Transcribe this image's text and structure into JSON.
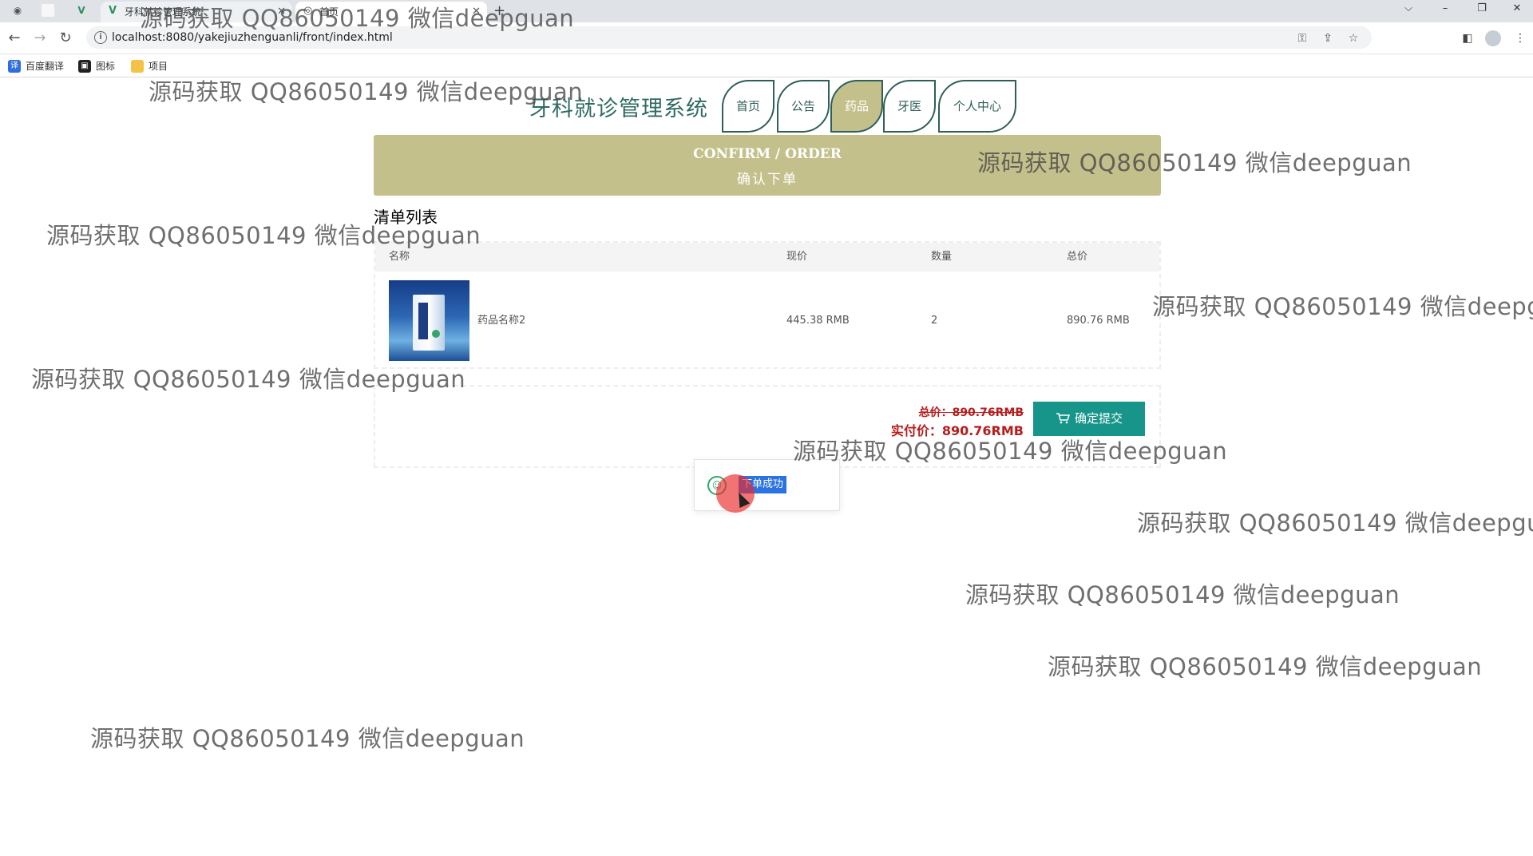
{
  "browser": {
    "tabs": [
      {
        "label": "",
        "icon": "blank-page-icon"
      },
      {
        "label": "牙科就诊管理系统",
        "icon": "vue-logo-icon"
      },
      {
        "label": "首页",
        "icon": "globe-icon"
      }
    ],
    "new_tab": "+",
    "url": "localhost:8080/yakejiuzhenguanli/front/index.html",
    "window_controls": {
      "dropdown": "⌵",
      "minimize": "–",
      "restore": "❐",
      "close": "✕"
    },
    "bookmarks": [
      {
        "label": "百度翻译",
        "icon": "baidu-translate-icon",
        "color": "#2f6de1"
      },
      {
        "label": "图标",
        "icon": "image-icon",
        "color": "#222222"
      },
      {
        "label": "项目",
        "icon": "folder-icon",
        "color": "#f3c246"
      }
    ]
  },
  "site": {
    "title": "牙科就诊管理系统",
    "nav": [
      {
        "label": "首页",
        "active": false
      },
      {
        "label": "公告",
        "active": false
      },
      {
        "label": "药品",
        "active": true
      },
      {
        "label": "牙医",
        "active": false
      },
      {
        "label": "个人中心",
        "active": false
      }
    ],
    "accent": "#c4c08c",
    "nav_color": "#2e5f59"
  },
  "banner": {
    "en": "CONFIRM / ORDER",
    "cn": "确认下单"
  },
  "list": {
    "title": "清单列表",
    "headers": {
      "name": "名称",
      "price": "现价",
      "qty": "数量",
      "total": "总价"
    },
    "rows": [
      {
        "name": "药品名称2",
        "price": "445.38 RMB",
        "qty": "2",
        "total": "890.76 RMB"
      }
    ]
  },
  "summary": {
    "total_label": "总价：890.76RMB",
    "paid_label": "实付价：890.76RMB",
    "submit": "确定提交",
    "price_color": "#b91c1c",
    "button_color": "#17958a"
  },
  "toast": {
    "message": "下单成功",
    "icon": "success-smile-icon"
  },
  "watermark": "源码获取 QQ86050149 微信deepguan"
}
